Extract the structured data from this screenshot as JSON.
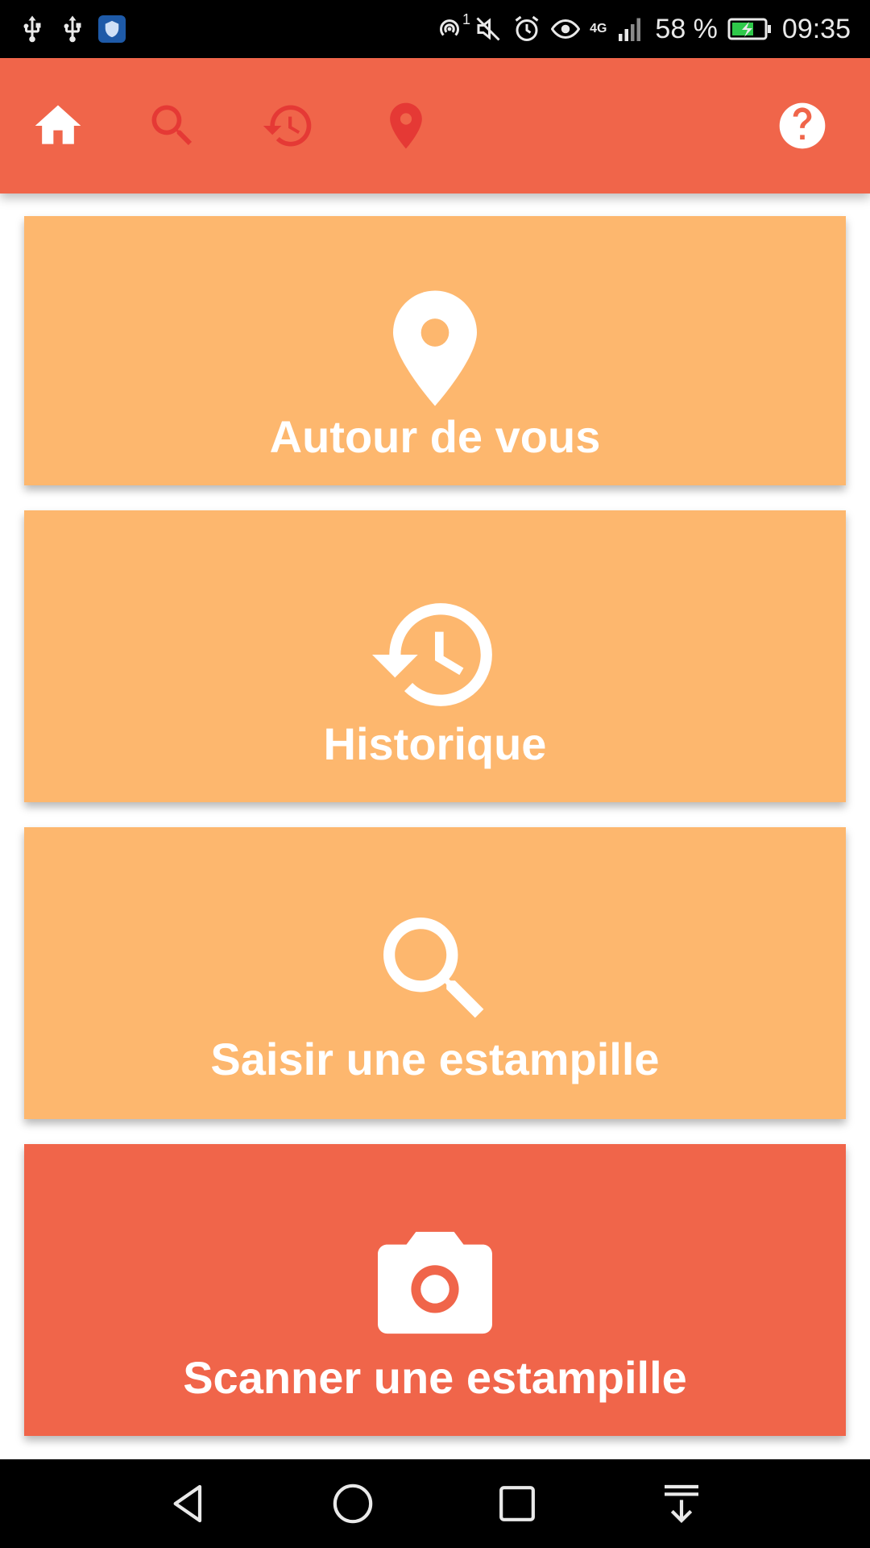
{
  "status_bar": {
    "battery_percent_text": "58 %",
    "time": "09:35",
    "network_type": "4G",
    "hotspot_count": "1",
    "left_icons": [
      "usb-icon",
      "usb-icon",
      "shield-app-icon"
    ],
    "right_icons": [
      "hotspot-icon",
      "mute-icon",
      "alarm-icon",
      "eye-icon",
      "signal-icon",
      "battery-charging-icon"
    ]
  },
  "toolbar": {
    "items": [
      {
        "icon": "home-icon",
        "active": true
      },
      {
        "icon": "search-icon",
        "active": false
      },
      {
        "icon": "history-icon",
        "active": false
      },
      {
        "icon": "location-pin-icon",
        "active": false
      }
    ],
    "help_icon": "help-icon",
    "colors": {
      "background": "#f0654a",
      "active_icon": "#ffffff",
      "inactive_icon": "#e53935"
    }
  },
  "cards": [
    {
      "label": "Autour de vous",
      "icon": "location-pin-icon",
      "color": "#fdb76e"
    },
    {
      "label": "Historique",
      "icon": "history-icon",
      "color": "#fdb76e"
    },
    {
      "label": "Saisir une estampille",
      "icon": "search-icon",
      "color": "#fdb76e"
    },
    {
      "label": "Scanner une estampille",
      "icon": "camera-icon",
      "color": "#f0654a"
    }
  ],
  "nav_bar": {
    "buttons": [
      "back-icon",
      "home-circle-icon",
      "recents-icon",
      "notifications-pull-icon"
    ]
  }
}
